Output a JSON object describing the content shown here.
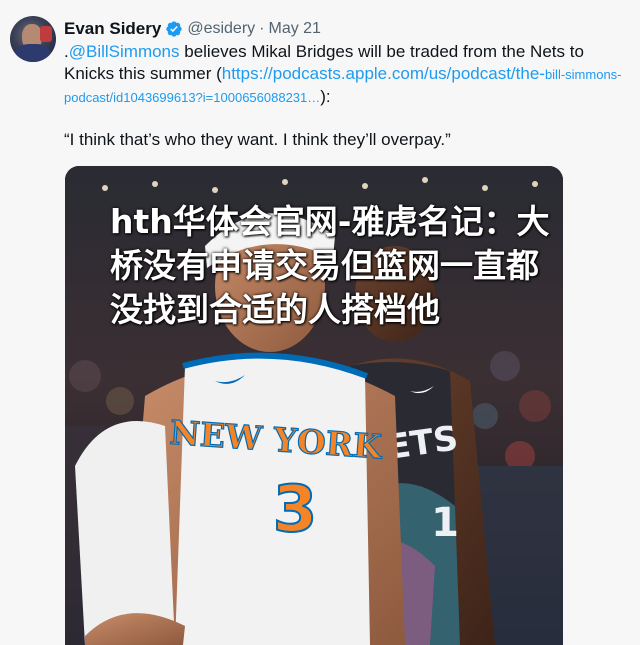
{
  "author": {
    "name": "Evan Sidery",
    "handle": "@esidery",
    "separator": "·",
    "date": "May 21"
  },
  "tweet": {
    "prefix": ".",
    "mention": "@BillSimmons",
    "text_part1": " believes Mikal Bridges will be traded from the Nets to Knicks this summer (",
    "url_big": "https://podcasts.apple.com/us/podcast/the-",
    "url_small": "bill-simmons-podcast/id1043699613?i=1000656088231…",
    "text_part2": "):",
    "quote": "“I think that’s who they want. I think they’ll overpay.”"
  },
  "media": {
    "jersey_left_text": "NEW YORK",
    "jersey_left_number": "3",
    "jersey_right_text": "NETS",
    "jersey_right_number": "1"
  },
  "overlay_title": "hth华体会官网-雅虎名记：大桥没有申请交易但篮网一直都没找到合适的人搭档他",
  "colors": {
    "link": "#1d9bf0",
    "verified": "#1d9bf0",
    "knicks_orange": "#f58426",
    "knicks_blue": "#006bb6"
  }
}
